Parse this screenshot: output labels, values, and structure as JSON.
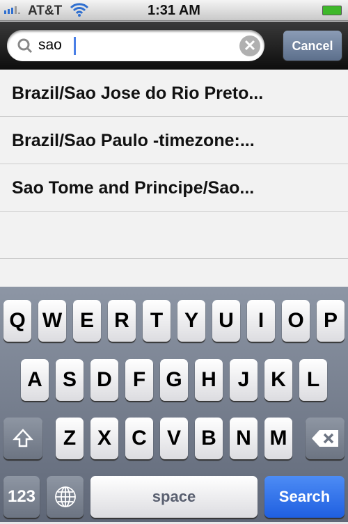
{
  "status": {
    "carrier": "AT&T",
    "time": "1:31 AM",
    "battery": "charging"
  },
  "search": {
    "value": "sao",
    "cancel_label": "Cancel",
    "icon": "search-icon",
    "clear_icon": "clear-icon"
  },
  "results": [
    "Brazil/Sao Jose do Rio Preto...",
    "Brazil/Sao Paulo -timezone:...",
    "Sao Tome and Principe/Sao..."
  ],
  "keyboard": {
    "row1": [
      "Q",
      "W",
      "E",
      "R",
      "T",
      "Y",
      "U",
      "I",
      "O",
      "P"
    ],
    "row2": [
      "A",
      "S",
      "D",
      "F",
      "G",
      "H",
      "J",
      "K",
      "L"
    ],
    "row3": [
      "Z",
      "X",
      "C",
      "V",
      "B",
      "N",
      "M"
    ],
    "numbers_label": "123",
    "space_label": "space",
    "search_label": "Search",
    "accent": "#2a6ae8"
  }
}
